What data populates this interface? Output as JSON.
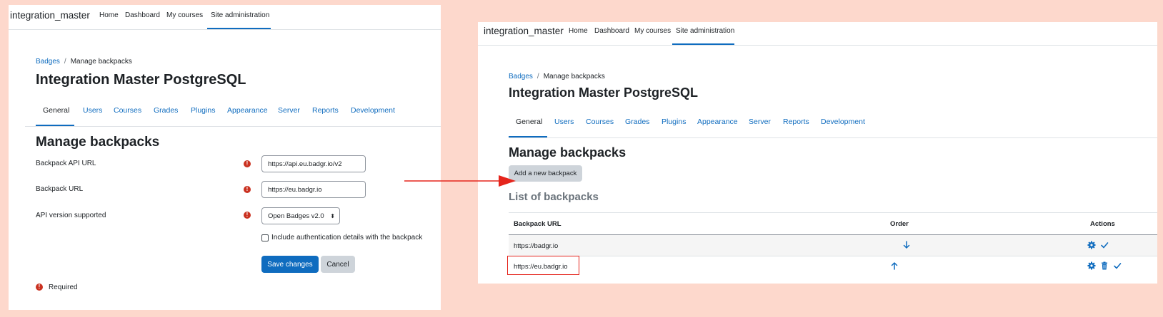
{
  "left": {
    "navbar": {
      "brand": "integration_master",
      "links": [
        "Home",
        "Dashboard",
        "My courses",
        "Site administration"
      ]
    },
    "breadcrumb": {
      "link": "Badges",
      "separator": "/",
      "current": "Manage backpacks"
    },
    "page_title": "Integration Master PostgreSQL",
    "tabs": [
      "General",
      "Users",
      "Courses",
      "Grades",
      "Plugins",
      "Appearance",
      "Server",
      "Reports",
      "Development"
    ],
    "heading": "Manage backpacks",
    "form": {
      "api_url_label": "Backpack API URL",
      "api_url_value": "https://api.eu.badgr.io/v2",
      "backpack_url_label": "Backpack URL",
      "backpack_url_value": "https://eu.badgr.io",
      "api_version_label": "API version supported",
      "api_version_value": "Open Badges v2.0",
      "include_auth_label": "Include authentication details with the backpack",
      "save_label": "Save changes",
      "cancel_label": "Cancel",
      "required_label": "Required"
    }
  },
  "right": {
    "navbar": {
      "brand": "integration_master",
      "links": [
        "Home",
        "Dashboard",
        "My courses",
        "Site administration"
      ]
    },
    "breadcrumb": {
      "link": "Badges",
      "separator": "/",
      "current": "Manage backpacks"
    },
    "page_title": "Integration Master PostgreSQL",
    "tabs": [
      "General",
      "Users",
      "Courses",
      "Grades",
      "Plugins",
      "Appearance",
      "Server",
      "Reports",
      "Development"
    ],
    "heading": "Manage backpacks",
    "add_button": "Add a new backpack",
    "list_heading": "List of backpacks",
    "table": {
      "headers": [
        "Backpack URL",
        "Order",
        "Actions"
      ],
      "rows": [
        {
          "url": "https://badgr.io",
          "order": "down",
          "actions": [
            "settings",
            "enable"
          ]
        },
        {
          "url": "https://eu.badgr.io",
          "order": "up",
          "actions": [
            "settings",
            "delete",
            "enable"
          ]
        }
      ]
    }
  },
  "colors": {
    "background": "#fdd8cc",
    "accent": "#0f6cbf",
    "required": "#ca3120",
    "annotation": "#e5251c"
  }
}
